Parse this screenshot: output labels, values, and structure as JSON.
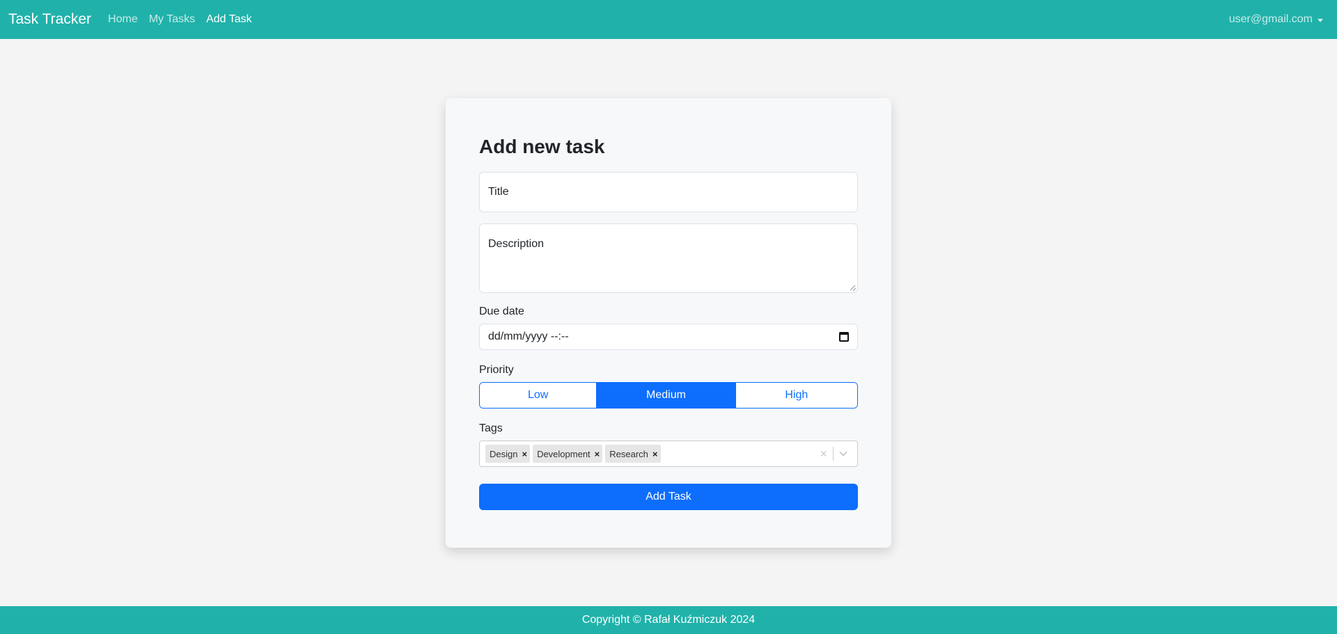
{
  "navbar": {
    "brand": "Task Tracker",
    "links": [
      "Home",
      "My Tasks",
      "Add Task"
    ],
    "user": "user@gmail.com"
  },
  "form": {
    "heading": "Add new task",
    "title_placeholder": "Title",
    "description_placeholder": "Description",
    "due_date_label": "Due date",
    "due_date_placeholder": "dd/mm/yyyy --:--",
    "priority_label": "Priority",
    "priority_options": [
      "Low",
      "Medium",
      "High"
    ],
    "priority_selected": "Medium",
    "tags_label": "Tags",
    "tags": [
      "Design",
      "Development",
      "Research"
    ],
    "tag_remove": "×",
    "clear_symbol": "×",
    "submit_label": "Add Task"
  },
  "footer": {
    "copyright": "Copyright © Rafał Kuźmiczuk 2024"
  },
  "colors": {
    "brand": "#20b2aa",
    "primary": "#0d6efd",
    "background": "#f4f4f4"
  }
}
